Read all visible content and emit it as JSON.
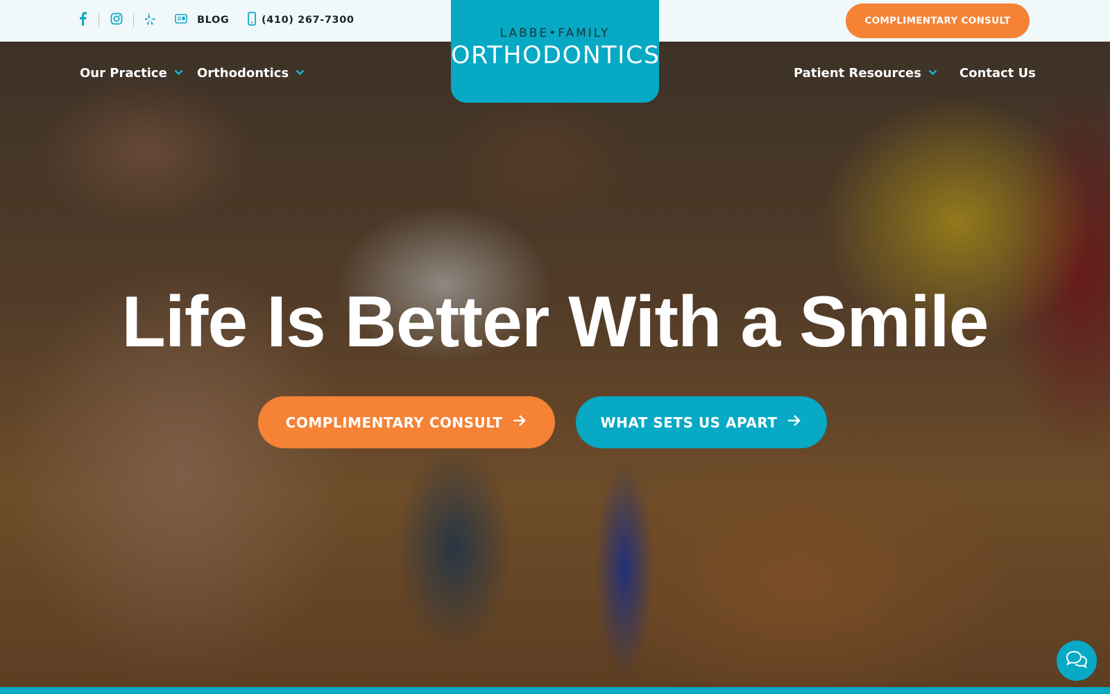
{
  "topbar": {
    "blog_label": "BLOG",
    "phone": "(410) 267-7300",
    "consult_label": "COMPLIMENTARY CONSULT",
    "icons": [
      "facebook-icon",
      "instagram-icon",
      "yelp-icon",
      "newspaper-icon",
      "phone-icon"
    ]
  },
  "logo": {
    "line1": "LABBE•FAMILY",
    "line2": "ORTHODONTICS"
  },
  "nav": {
    "our_practice": "Our Practice",
    "orthodontics": "Orthodontics",
    "patient_resources": "Patient Resources",
    "contact_us": "Contact Us"
  },
  "hero": {
    "headline": "Life Is Better With a Smile",
    "cta_consult": "COMPLIMENTARY CONSULT",
    "cta_apart": "WHAT SETS US APART"
  },
  "colors": {
    "accent_teal": "#07a9c4",
    "accent_orange": "#f58235"
  }
}
